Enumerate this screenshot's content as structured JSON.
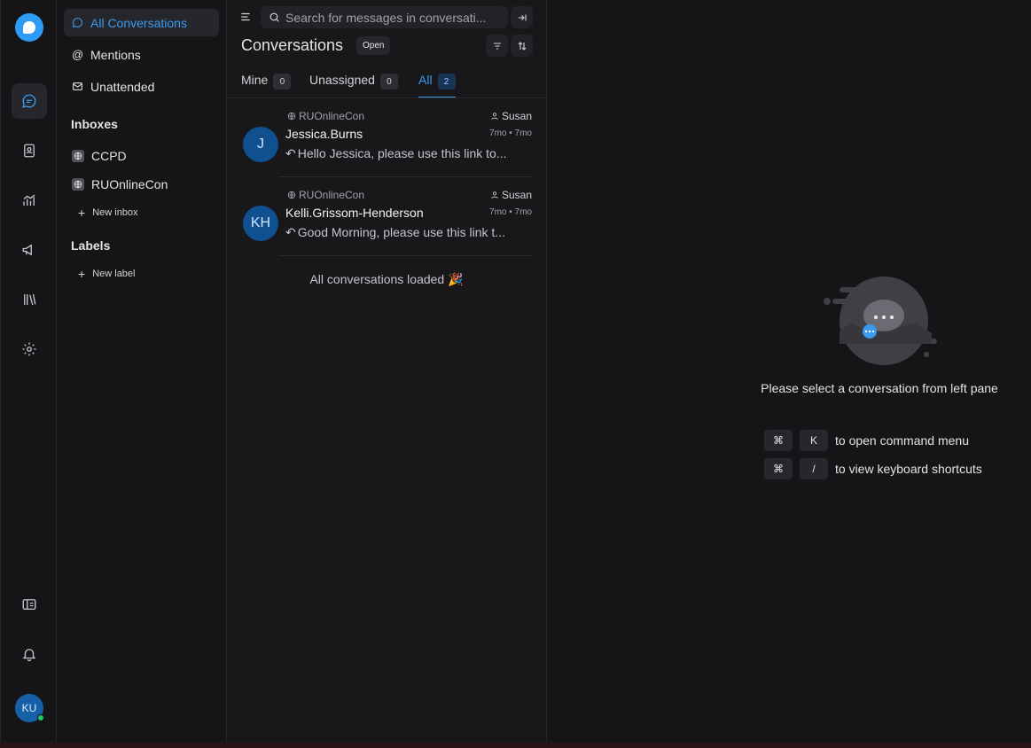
{
  "sidebar": {
    "items": [
      {
        "label": "All Conversations"
      },
      {
        "label": "Mentions"
      },
      {
        "label": "Unattended"
      }
    ],
    "inboxes_heading": "Inboxes",
    "inboxes": [
      {
        "label": "CCPD"
      },
      {
        "label": "RUOnlineCon"
      }
    ],
    "new_inbox": "New inbox",
    "labels_heading": "Labels",
    "new_label": "New label"
  },
  "user": {
    "initials": "KU",
    "status": "online"
  },
  "list": {
    "search_placeholder": "Search for messages in conversati...",
    "title": "Conversations",
    "status_badge": "Open",
    "tabs": [
      {
        "label": "Mine",
        "count": "0"
      },
      {
        "label": "Unassigned",
        "count": "0"
      },
      {
        "label": "All",
        "count": "2"
      }
    ],
    "conversations": [
      {
        "initials": "J",
        "inbox": "RUOnlineCon",
        "agent": "Susan",
        "name": "Jessica.Burns",
        "time": "7mo • 7mo",
        "message": "Hello Jessica, please use this link to..."
      },
      {
        "initials": "KH",
        "inbox": "RUOnlineCon",
        "agent": "Susan",
        "name": "Kelli.Grissom-Henderson",
        "time": "7mo • 7mo",
        "message": "Good Morning, please use this link t..."
      }
    ],
    "loaded_text": "All conversations loaded 🎉"
  },
  "empty_state": {
    "message": "Please select a conversation from left pane",
    "shortcuts": [
      {
        "keys": [
          "⌘",
          "K"
        ],
        "text": "to open command menu"
      },
      {
        "keys": [
          "⌘",
          "/"
        ],
        "text": "to view keyboard shortcuts"
      }
    ]
  },
  "colors": {
    "accent": "#3b9bf0",
    "avatar": "#10508f",
    "online": "#22c55e"
  }
}
